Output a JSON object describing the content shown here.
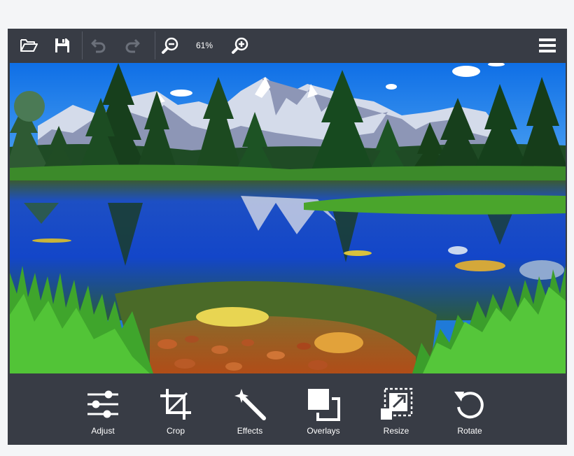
{
  "toolbar": {
    "zoom_level": "61%",
    "buttons": [
      {
        "name": "open-folder",
        "icon": "folder-open-icon",
        "enabled": true
      },
      {
        "name": "save",
        "icon": "floppy-disk-icon",
        "enabled": true
      },
      {
        "name": "undo",
        "icon": "undo-icon",
        "enabled": false
      },
      {
        "name": "redo",
        "icon": "redo-icon",
        "enabled": false
      },
      {
        "name": "zoom-out",
        "icon": "zoom-out-icon",
        "enabled": true
      },
      {
        "name": "zoom-in",
        "icon": "zoom-in-icon",
        "enabled": true
      },
      {
        "name": "menu",
        "icon": "hamburger-menu-icon",
        "enabled": true
      }
    ]
  },
  "canvas": {
    "image_subject": "landscape-photo"
  },
  "tools": [
    {
      "label": "Adjust",
      "icon": "sliders-icon"
    },
    {
      "label": "Crop",
      "icon": "crop-icon"
    },
    {
      "label": "Effects",
      "icon": "magic-wand-icon"
    },
    {
      "label": "Overlays",
      "icon": "overlays-icon"
    },
    {
      "label": "Resize",
      "icon": "resize-icon"
    },
    {
      "label": "Rotate",
      "icon": "rotate-icon"
    }
  ],
  "colors": {
    "toolbar_bg": "#383c45",
    "page_bg": "#f4f5f7",
    "icon_active": "#ffffff",
    "icon_disabled": "#6b707a"
  }
}
